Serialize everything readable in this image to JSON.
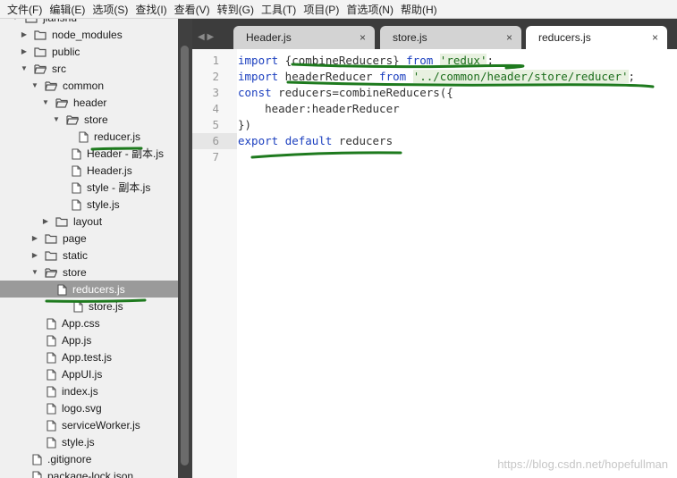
{
  "menu": [
    "文件(F)",
    "编辑(E)",
    "选项(S)",
    "查找(I)",
    "查看(V)",
    "转到(G)",
    "工具(T)",
    "项目(P)",
    "首选项(N)",
    "帮助(H)"
  ],
  "sidebar": {
    "root": "jianshu",
    "items": [
      {
        "label": "node_modules",
        "type": "folder",
        "state": "closed"
      },
      {
        "label": "public",
        "type": "folder",
        "state": "closed"
      },
      {
        "label": "src",
        "type": "folder",
        "state": "open"
      },
      {
        "label": "common",
        "type": "folder",
        "state": "open"
      },
      {
        "label": "header",
        "type": "folder",
        "state": "open"
      },
      {
        "label": "store",
        "type": "folder",
        "state": "open"
      },
      {
        "label": "reducer.js",
        "type": "file"
      },
      {
        "label": "Header - 副本.js",
        "type": "file"
      },
      {
        "label": "Header.js",
        "type": "file"
      },
      {
        "label": "style - 副本.js",
        "type": "file"
      },
      {
        "label": "style.js",
        "type": "file"
      },
      {
        "label": "layout",
        "type": "folder",
        "state": "closed"
      },
      {
        "label": "page",
        "type": "folder",
        "state": "closed"
      },
      {
        "label": "static",
        "type": "folder",
        "state": "closed"
      },
      {
        "label": "store",
        "type": "folder",
        "state": "open"
      },
      {
        "label": "reducers.js",
        "type": "file",
        "selected": true
      },
      {
        "label": "store.js",
        "type": "file"
      },
      {
        "label": "App.css",
        "type": "file"
      },
      {
        "label": "App.js",
        "type": "file"
      },
      {
        "label": "App.test.js",
        "type": "file"
      },
      {
        "label": "AppUI.js",
        "type": "file"
      },
      {
        "label": "index.js",
        "type": "file"
      },
      {
        "label": "logo.svg",
        "type": "file"
      },
      {
        "label": "serviceWorker.js",
        "type": "file"
      },
      {
        "label": "style.js",
        "type": "file"
      },
      {
        "label": ".gitignore",
        "type": "file"
      },
      {
        "label": "package-lock.json",
        "type": "file"
      }
    ]
  },
  "tabs": [
    {
      "label": "Header.js",
      "close": "×"
    },
    {
      "label": "store.js",
      "close": "×"
    },
    {
      "label": "reducers.js",
      "close": "×",
      "active": true
    }
  ],
  "tab_nav": "◀ ▶",
  "editor": {
    "line_numbers": [
      "1",
      "2",
      "3",
      "4",
      "5",
      "6",
      "7"
    ],
    "highlighted_line": "6",
    "lines": [
      [
        {
          "t": "import",
          "c": "kw"
        },
        {
          "t": " {combineReducers} "
        },
        {
          "t": "from",
          "c": "kw"
        },
        {
          "t": " "
        },
        {
          "t": "'redux'",
          "c": "str"
        },
        {
          "t": ";"
        }
      ],
      [
        {
          "t": "import",
          "c": "kw"
        },
        {
          "t": " headerReducer "
        },
        {
          "t": "from",
          "c": "kw"
        },
        {
          "t": " "
        },
        {
          "t": "'../common/header/store/reducer'",
          "c": "str"
        },
        {
          "t": ";"
        }
      ],
      [
        {
          "t": "const",
          "c": "kw"
        },
        {
          "t": " reducers=combineReducers({"
        }
      ],
      [
        {
          "t": "    header:headerReducer"
        }
      ],
      [
        {
          "t": "})"
        }
      ],
      [
        {
          "t": "export",
          "c": "kw"
        },
        {
          "t": " "
        },
        {
          "t": "default",
          "c": "kw"
        },
        {
          "t": " reducers"
        }
      ],
      []
    ]
  },
  "watermark": "https://blog.csdn.net/hopefullman",
  "colors": {
    "keyword": "#1b3fbf",
    "string": "#1b6d1b",
    "annotation": "#1e7a1e"
  }
}
